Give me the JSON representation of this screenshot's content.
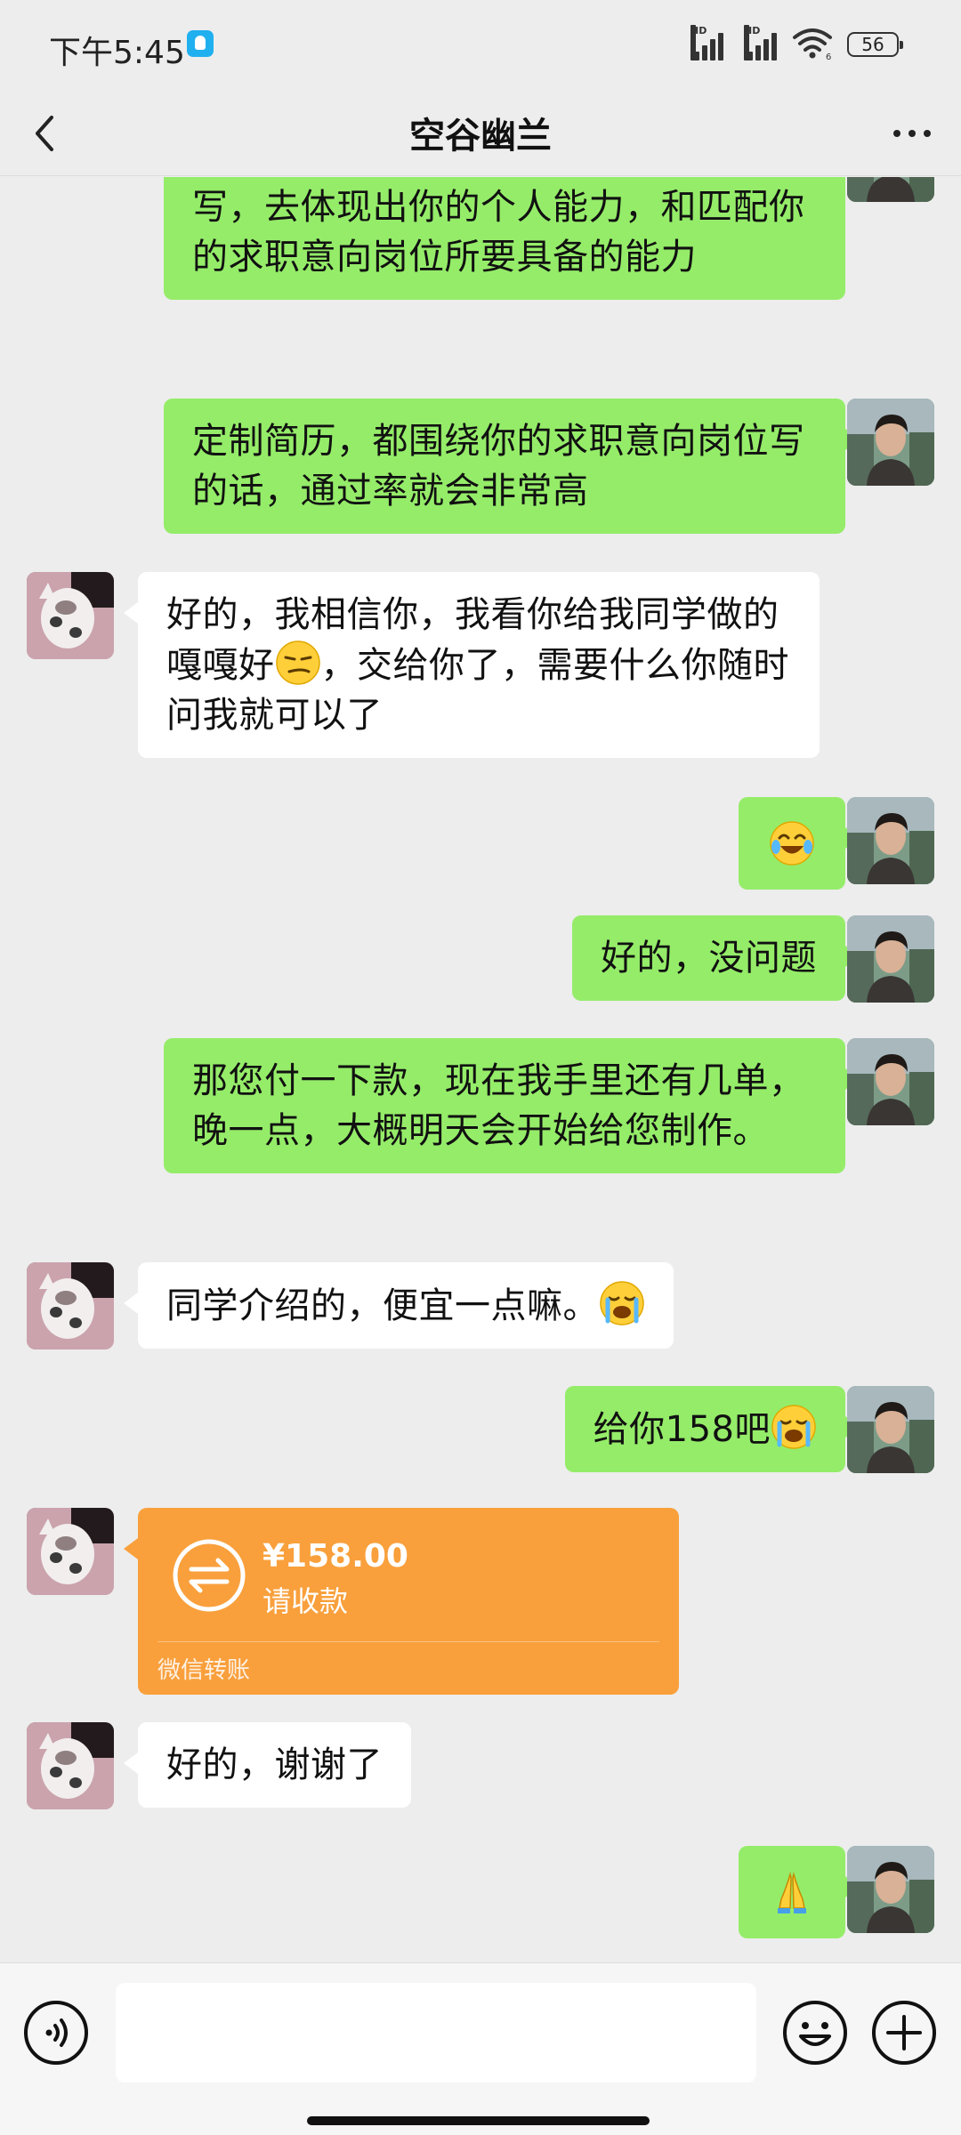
{
  "status_bar": {
    "time": "下午5:45",
    "battery": "56",
    "signal_label": "HD",
    "wifi_label": "6"
  },
  "header": {
    "title": "空谷幽兰"
  },
  "messages": [
    {
      "side": "me",
      "text": "但是每一个工作经历你都没有细化的去写，去体现出你的个人能力，和匹配你的求职意向岗位所要具备的能力"
    },
    {
      "side": "me",
      "text": "定制简历，都围绕你的求职意向岗位写的话，通过率就会非常高"
    },
    {
      "side": "other",
      "text_before": "好的，我相信你，我看你给我同学做的嘎嘎好",
      "emoji": "smirk-emoji",
      "text_after": "，交给你了，需要什么你随时问我就可以了"
    },
    {
      "side": "me",
      "emoji": "tears-of-joy-emoji"
    },
    {
      "side": "me",
      "text": "好的，没问题"
    },
    {
      "side": "me",
      "text": "那您付一下款，现在我手里还有几单，晚一点，大概明天会开始给您制作。"
    },
    {
      "side": "other",
      "text": "同学介绍的，便宜一点嘛。",
      "emoji": "loudly-crying-emoji"
    },
    {
      "side": "me",
      "text": "给你158吧",
      "emoji": "loudly-crying-emoji"
    },
    {
      "side": "other",
      "type": "transfer",
      "amount": "¥158.00",
      "status": "请收款",
      "label": "微信转账"
    },
    {
      "side": "other",
      "text": "好的，谢谢了"
    },
    {
      "side": "me",
      "emoji": "folded-hands-emoji"
    }
  ],
  "colors": {
    "my_bubble": "#95ec69",
    "their_bubble": "#ffffff",
    "transfer_card": "#f9a03c",
    "background": "#ededed"
  }
}
